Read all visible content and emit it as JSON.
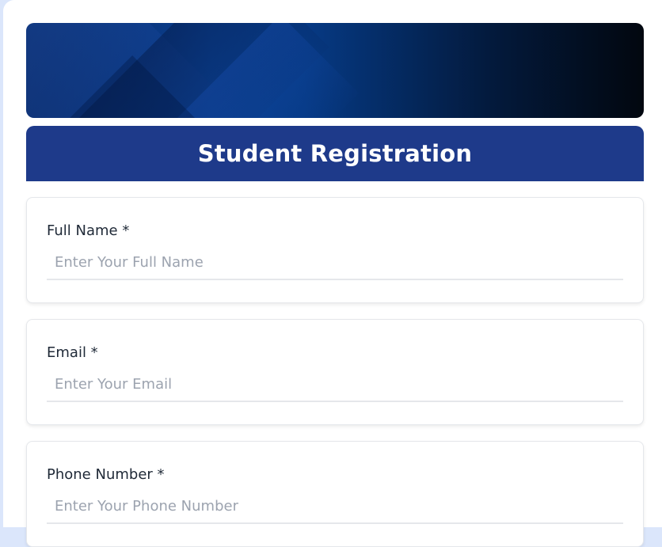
{
  "header": {
    "title": "Student Registration"
  },
  "fields": [
    {
      "label": "Full Name *",
      "placeholder": "Enter Your Full Name",
      "value": ""
    },
    {
      "label": "Email *",
      "placeholder": "Enter Your Email",
      "value": ""
    },
    {
      "label": "Phone Number *",
      "placeholder": "Enter Your Phone Number",
      "value": ""
    }
  ]
}
